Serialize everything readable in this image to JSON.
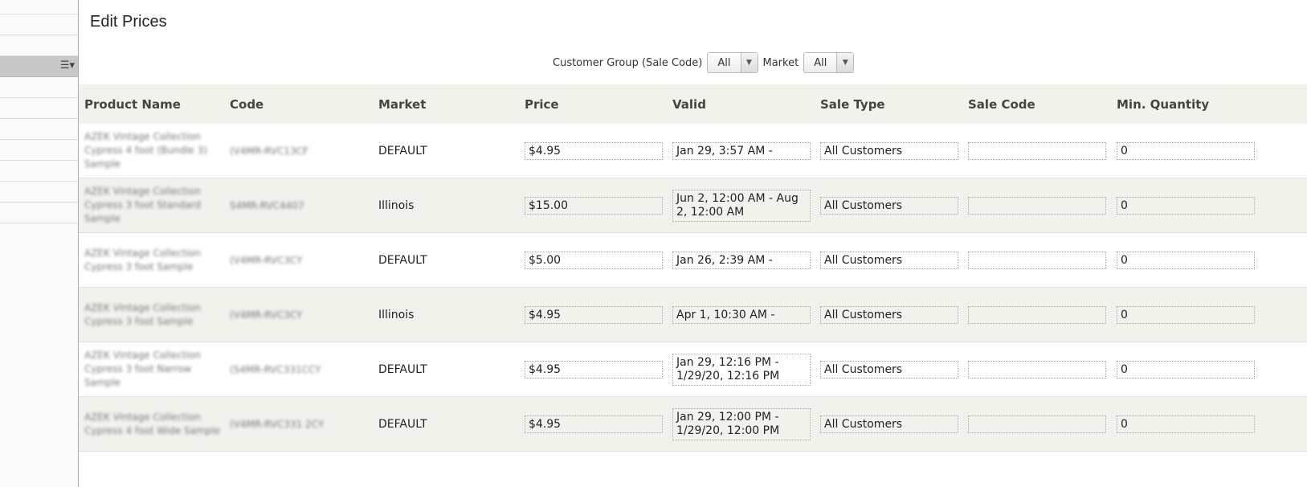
{
  "page_title": "Edit Prices",
  "filters": {
    "customer_group_label": "Customer Group (Sale Code)",
    "customer_group_value": "All",
    "market_label": "Market",
    "market_value": "All"
  },
  "table": {
    "headers": [
      "Product Name",
      "Code",
      "Market",
      "Price",
      "Valid",
      "Sale Type",
      "Sale Code",
      "Min. Quantity"
    ],
    "rows": [
      {
        "product": "AZEK Vintage Collection Cypress 4 foot (Bundle 3) Sample",
        "code": "(V4MR-RVC13CF",
        "market": "DEFAULT",
        "price": "$4.95",
        "valid": "Jan 29, 3:57 AM -",
        "sale_type": "All Customers",
        "sale_code": "",
        "min_qty": "0"
      },
      {
        "product": "AZEK Vintage Collection Cypress 3 foot Standard Sample",
        "code": "S4MR-RVC4407",
        "market": "Illinois",
        "price": "$15.00",
        "valid": "Jun 2, 12:00 AM - Aug 2, 12:00 AM",
        "sale_type": "All Customers",
        "sale_code": "",
        "min_qty": "0"
      },
      {
        "product": "AZEK Vintage Collection Cypress 3 foot Sample",
        "code": "(V4MR-RVC3CY",
        "market": "DEFAULT",
        "price": "$5.00",
        "valid": "Jan 26, 2:39 AM -",
        "sale_type": "All Customers",
        "sale_code": "",
        "min_qty": "0"
      },
      {
        "product": "AZEK Vintage Collection Cypress 3 foot Sample",
        "code": "(V4MR-RVC3CY",
        "market": "Illinois",
        "price": "$4.95",
        "valid": "Apr 1, 10:30 AM -",
        "sale_type": "All Customers",
        "sale_code": "",
        "min_qty": "0"
      },
      {
        "product": "AZEK Vintage Collection Cypress 3 foot Narrow Sample",
        "code": "(S4MR-RVC331CCY",
        "market": "DEFAULT",
        "price": "$4.95",
        "valid": "Jan 29, 12:16 PM - 1/29/20, 12:16 PM",
        "sale_type": "All Customers",
        "sale_code": "",
        "min_qty": "0"
      },
      {
        "product": "AZEK Vintage Collection Cypress 4 foot Wide Sample",
        "code": "(V4MR-RVC331 2CY",
        "market": "DEFAULT",
        "price": "$4.95",
        "valid": "Jan 29, 12:00 PM - 1/29/20, 12:00 PM",
        "sale_type": "All Customers",
        "sale_code": "",
        "min_qty": "0"
      }
    ]
  }
}
